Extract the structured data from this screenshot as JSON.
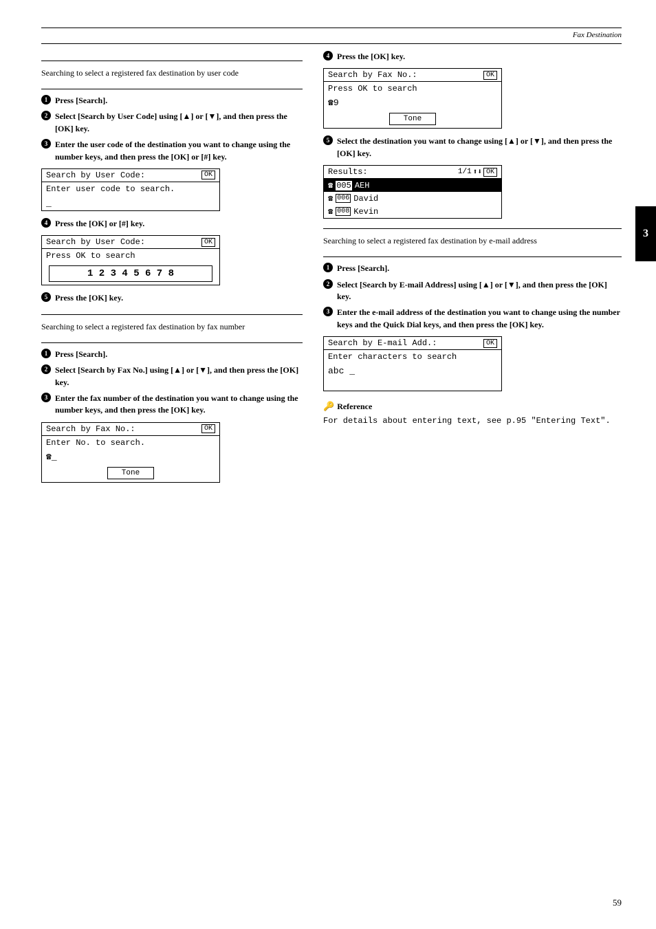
{
  "page": {
    "header_title": "Fax Destination",
    "page_number": "59",
    "tab_number": "3"
  },
  "left_col": {
    "section1": {
      "heading": "Searching to select a registered fax destination by user code",
      "steps": [
        {
          "num": "1",
          "text": "Press [Search]."
        },
        {
          "num": "2",
          "text": "Select [Search by User Code] using [▲] or [▼], and then press the [OK] key."
        },
        {
          "num": "3",
          "text": "Enter the user code of the destination you want to change using the number keys, and then press the [OK] or [#] key."
        }
      ],
      "lcd1": {
        "title": "Search by User Code:",
        "ok_label": "OK",
        "row2": "Enter user code to search.",
        "row3": "_"
      },
      "step4": {
        "num": "4",
        "text": "Press the [OK] or [#] key."
      },
      "lcd2": {
        "title": "Search by User Code:",
        "ok_label": "OK",
        "row2": "Press OK to search",
        "row3": "1 2 3 4 5 6 7 8"
      },
      "step5": {
        "num": "5",
        "text": "Press the [OK] key."
      }
    },
    "section2": {
      "heading": "Searching to select a registered fax destination by fax number",
      "steps": [
        {
          "num": "1",
          "text": "Press [Search]."
        },
        {
          "num": "2",
          "text": "Select [Search by Fax No.] using [▲] or [▼], and then press the [OK] key."
        },
        {
          "num": "3",
          "text": "Enter the fax number of the destination you want to change using the number keys, and then press the [OK] key."
        }
      ],
      "lcd3": {
        "title": "Search by Fax No.:",
        "ok_label": "OK",
        "row2": "Enter No. to search.",
        "row3": "☎_",
        "tone_button": "Tone"
      }
    }
  },
  "right_col": {
    "step4_fax": {
      "num": "4",
      "text": "Press the [OK] key."
    },
    "lcd4": {
      "title": "Search by Fax No.:",
      "ok_label": "OK",
      "row2": "Press OK to search",
      "row3": "☎9",
      "tone_button": "Tone"
    },
    "step5_fax": {
      "num": "5",
      "text": "Select the destination you want to change using [▲] or [▼], and then press the [OK] key."
    },
    "lcd5": {
      "title": "Results:",
      "page_info": "1/1",
      "nav_icon": "⬆⬇",
      "ok_label": "OK",
      "rows": [
        {
          "icon": "☎",
          "num": "005",
          "name": "AEH",
          "selected": true
        },
        {
          "icon": "☎",
          "num": "006",
          "name": "David",
          "selected": false
        },
        {
          "icon": "☎",
          "num": "008",
          "name": "Kevin",
          "selected": false
        }
      ]
    },
    "section3": {
      "heading": "Searching to select a registered fax destination by e-mail address",
      "steps": [
        {
          "num": "1",
          "text": "Press [Search]."
        },
        {
          "num": "2",
          "text": "Select [Search by E-mail Address] using [▲] or [▼], and then press the [OK] key."
        },
        {
          "num": "3",
          "text": "Enter the e-mail address of the destination you want to change using the number keys and the Quick Dial keys, and then press the [OK] key."
        }
      ],
      "lcd6": {
        "title": "Search by E-mail Add.:",
        "ok_label": "OK",
        "row2": "Enter characters to search",
        "row3": "abc _"
      }
    },
    "reference": {
      "title": "Reference",
      "text": "For details about entering text, see p.95 \"Entering Text\"."
    }
  }
}
